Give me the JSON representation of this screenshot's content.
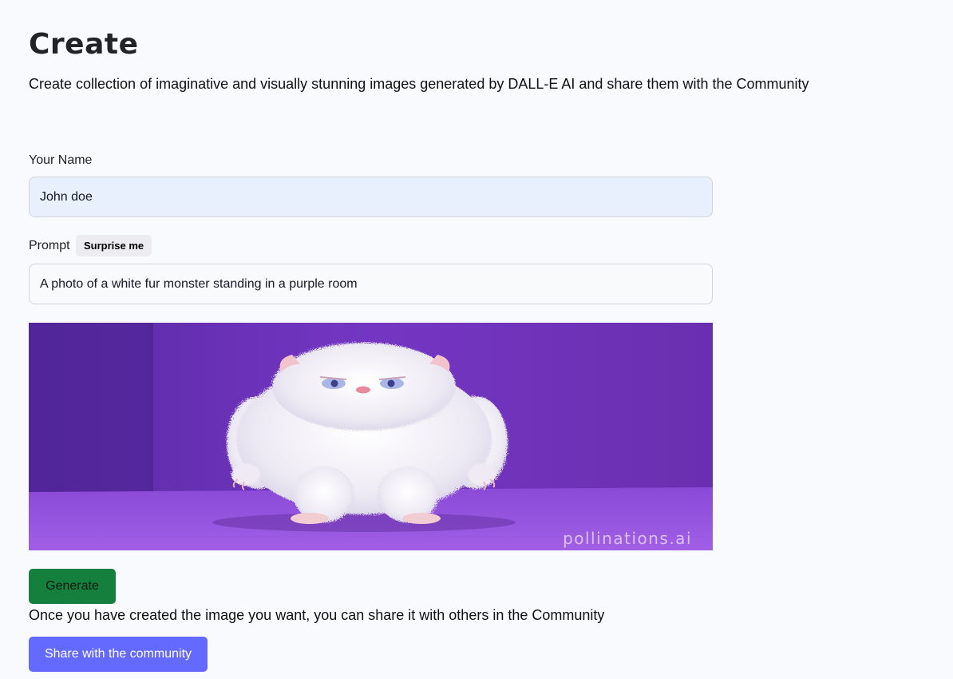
{
  "header": {
    "title": "Create",
    "subtitle": "Create collection of imaginative and visually stunning images generated by DALL-E AI and share them with the Community"
  },
  "form": {
    "name_label": "Your Name",
    "name_value": "John doe",
    "prompt_label": "Prompt",
    "surprise_label": "Surprise me",
    "prompt_value": "A photo of a white fur monster standing in a purple room"
  },
  "image": {
    "alt": "A photo of a white fur monster standing in a purple room",
    "watermark": "pollinations.ai"
  },
  "actions": {
    "generate_label": "Generate",
    "share_note": "Once you have created the image you want, you can share it with others in the Community",
    "share_label": "Share with the community"
  },
  "colors": {
    "background": "#f9fafe",
    "generate_button": "#15803d",
    "share_button": "#6469ff",
    "name_field_bg": "#e8f0fe"
  }
}
